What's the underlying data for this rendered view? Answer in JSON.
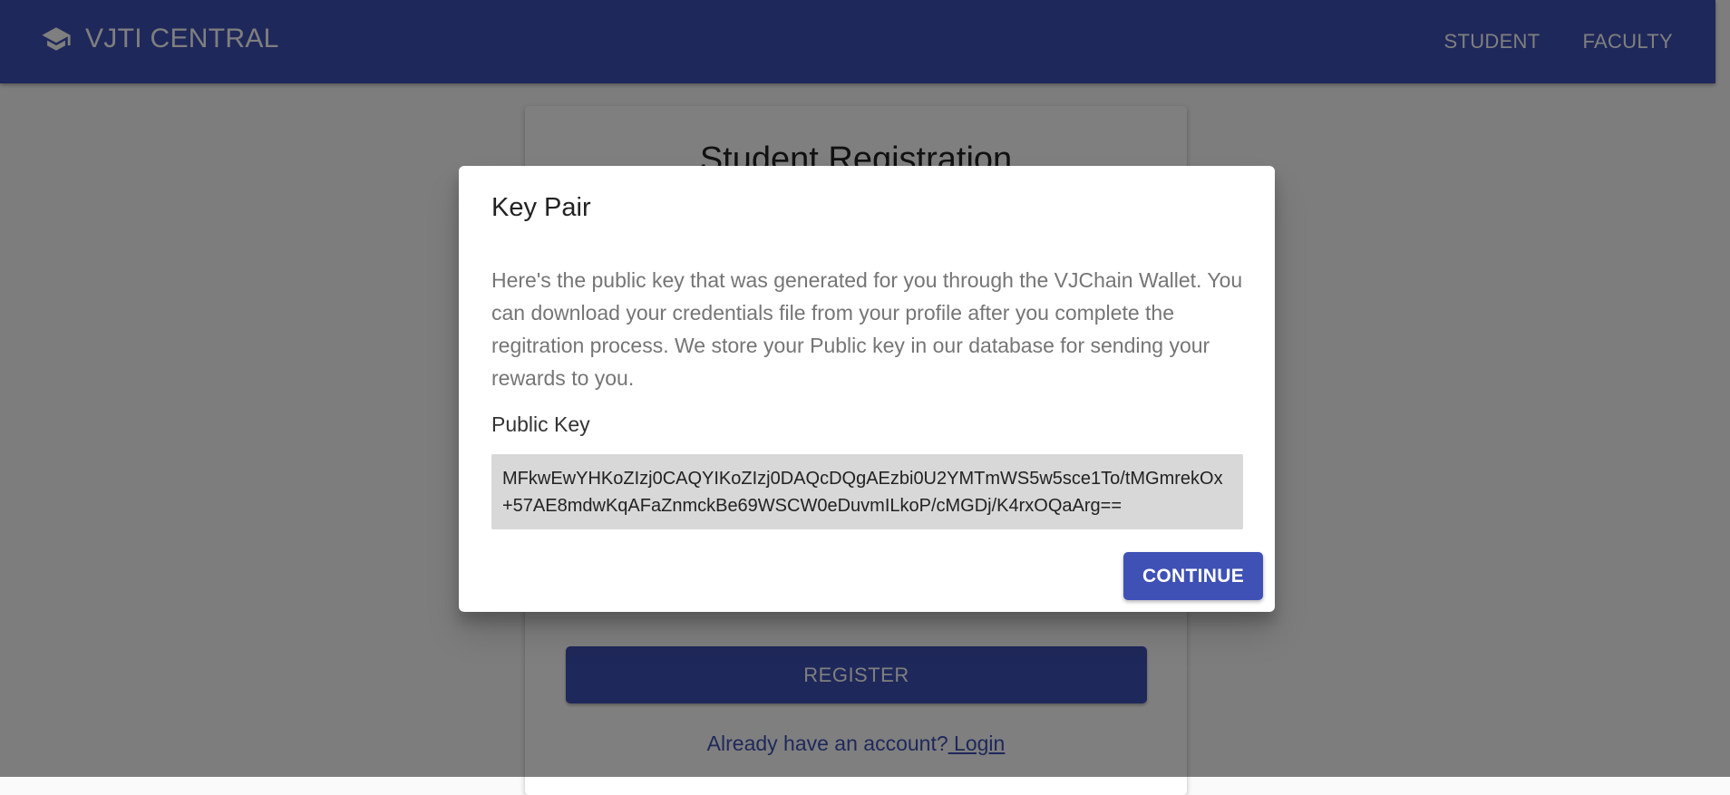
{
  "header": {
    "brand_icon": "graduation-cap-icon",
    "title": "VJTI CENTRAL",
    "nav": [
      {
        "label": "STUDENT"
      },
      {
        "label": "FACULTY"
      }
    ]
  },
  "registration": {
    "title": "Student Registration",
    "register_label": "REGISTER",
    "login_prompt": "Already have an account?",
    "login_link": " Login"
  },
  "dialog": {
    "title": "Key Pair",
    "body": "Here's the public key that was generated for you through the VJChain Wallet. You can download your credentials file from your profile after you complete the regitration process. We store your Public key in our database for sending your rewards to you.",
    "key_label": "Public Key",
    "public_key": "MFkwEwYHKoZIzj0CAQYIKoZIzj0DAQcDQgAEzbi0U2YMTmWS5w5sce1To/tMGmrekOx+57AE8mdwKqAFaZnmckBe69WSCW0eDuvmILkoP/cMGDj/K4rxOQaArg==",
    "continue_label": "CONTINUE"
  },
  "colors": {
    "primary": "#3f51b5",
    "overlay": "rgba(0,0,0,0.5)"
  }
}
